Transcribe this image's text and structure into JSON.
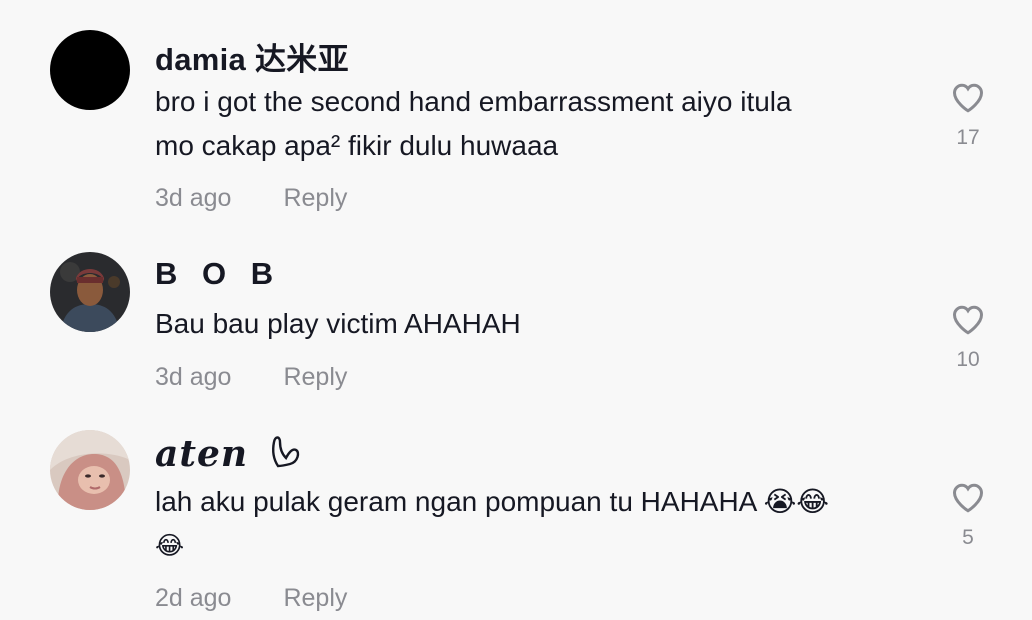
{
  "comments": [
    {
      "username": "damia 达米亚",
      "text_line1": "bro i got the second hand embarrassment aiyo itula",
      "text_line2": "mo cakap apa² fikir dulu huwaaa",
      "time": "3d ago",
      "reply_label": "Reply",
      "likes": "17",
      "avatar": "black-circle"
    },
    {
      "username": "B O B",
      "text_line1": "Bau bau play victim AHAHAH",
      "time": "3d ago",
      "reply_label": "Reply",
      "likes": "10",
      "avatar": "photo-man-cap"
    },
    {
      "username": "aten",
      "username_suffix_icon": "heart-outline-icon",
      "text_line1": "lah aku pulak geram ngan pompuan tu HAHAHA 😭😂",
      "text_line2": "😂",
      "time": "2d ago",
      "reply_label": "Reply",
      "likes": "5",
      "avatar": "photo-woman-hijab"
    }
  ],
  "colors": {
    "background": "#f8f8f8",
    "text": "#161823",
    "muted": "#8a8b91"
  }
}
